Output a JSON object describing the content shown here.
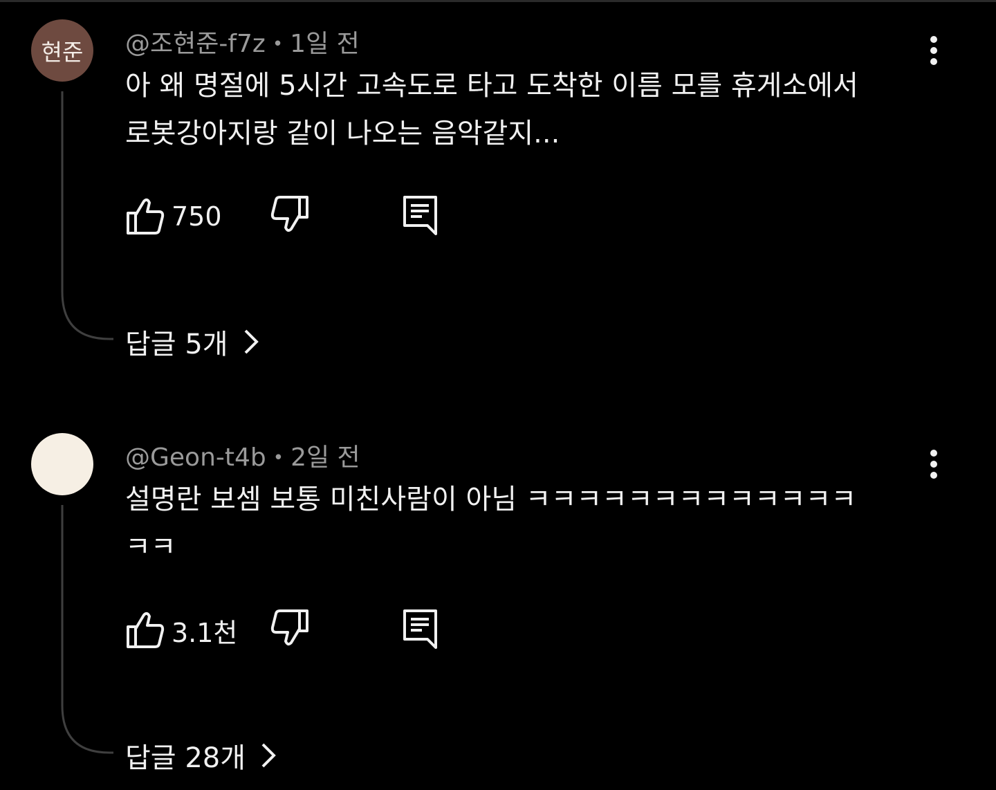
{
  "comments": [
    {
      "avatar_text": "현준",
      "avatar_color": "#6e4a40",
      "author": "@조현준-f7z",
      "separator": "•",
      "time": "1일 전",
      "text_lines": [
        "아 왜 명절에 5시간 고속도로 타고 도착한 이름 모를 휴게소에서",
        "로봇강아지랑 같이 나오는 음악같지..."
      ],
      "likes": "750",
      "replies_label": "답글 5개",
      "icons": {
        "like": "thumbs-up-icon",
        "dislike": "thumbs-down-icon",
        "reply": "comment-icon",
        "more": "more-vertical-icon",
        "expand": "chevron-right-icon"
      }
    },
    {
      "avatar_text": "",
      "avatar_color": "#f6efe4",
      "author": "@Geon-t4b",
      "separator": "•",
      "time": "2일 전",
      "text_lines": [
        "설명란 보셈 보통 미친사람이 아님 ㅋㅋㅋㅋㅋㅋㅋㅋㅋㅋㅋㅋㅋ",
        "ㅋㅋ"
      ],
      "likes": "3.1천",
      "replies_label": "답글 28개",
      "icons": {
        "like": "thumbs-up-icon",
        "dislike": "thumbs-down-icon",
        "reply": "comment-icon",
        "more": "more-vertical-icon",
        "expand": "chevron-right-icon"
      }
    }
  ]
}
